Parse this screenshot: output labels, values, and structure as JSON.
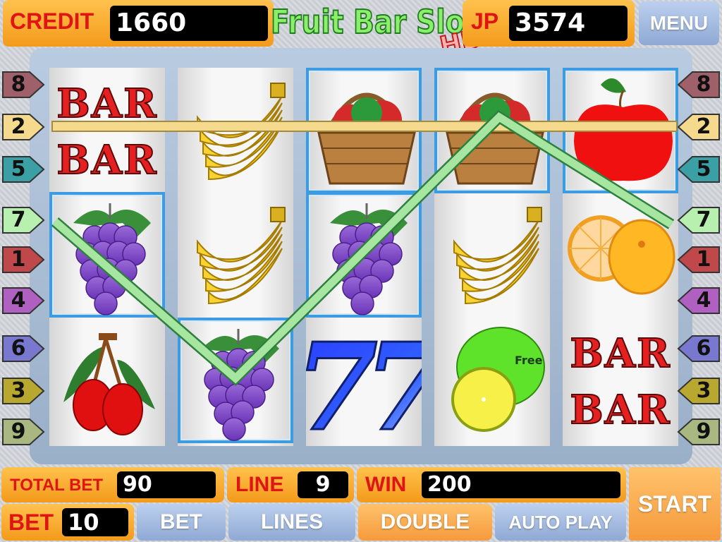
{
  "header": {
    "credit_label": "CREDIT",
    "credit_value": "1660",
    "logo_main": "Fruit Bar Slot",
    "logo_suffix": "HD",
    "jp_label": "JP",
    "jp_value": "3574",
    "menu_label": "MENU"
  },
  "reels": [
    [
      "bar",
      "grape",
      "cherry"
    ],
    [
      "banana",
      "banana",
      "grape"
    ],
    [
      "basket",
      "grape",
      "seven"
    ],
    [
      "basket",
      "banana",
      "lime"
    ],
    [
      "apple",
      "orange",
      "bar"
    ]
  ],
  "highlighted_cells": [
    [
      0,
      1
    ],
    [
      1,
      2
    ],
    [
      2,
      0
    ],
    [
      2,
      1
    ],
    [
      3,
      0
    ],
    [
      4,
      0
    ]
  ],
  "symbol_labels": {
    "bar": "BAR",
    "seven": "77",
    "lime_text": "Free"
  },
  "lines_left": [
    "8",
    "2",
    "5",
    "7",
    "1",
    "4",
    "6",
    "3",
    "9"
  ],
  "lines_right": [
    "8",
    "2",
    "5",
    "7",
    "1",
    "4",
    "6",
    "3",
    "9"
  ],
  "line_colors": {
    "8": "#a0606a",
    "2": "#f5d98c",
    "5": "#3aa0a6",
    "7": "#b8f0b0",
    "1": "#c0484a",
    "4": "#b060c0",
    "6": "#7878d0",
    "3": "#b8a830",
    "9": "#a8b880"
  },
  "footer": {
    "total_bet_label": "TOTAL BET",
    "total_bet_value": "90",
    "line_label": "LINE",
    "line_value": "9",
    "win_label": "WIN",
    "win_value": "200",
    "bet_label": "BET",
    "bet_value": "10",
    "start_label": "START",
    "bet_button": "BET",
    "lines_button": "LINES",
    "double_button": "DOUBLE",
    "autoplay_button": "AUTO PLAY"
  },
  "win_lines_shown": [
    "2",
    "7"
  ]
}
